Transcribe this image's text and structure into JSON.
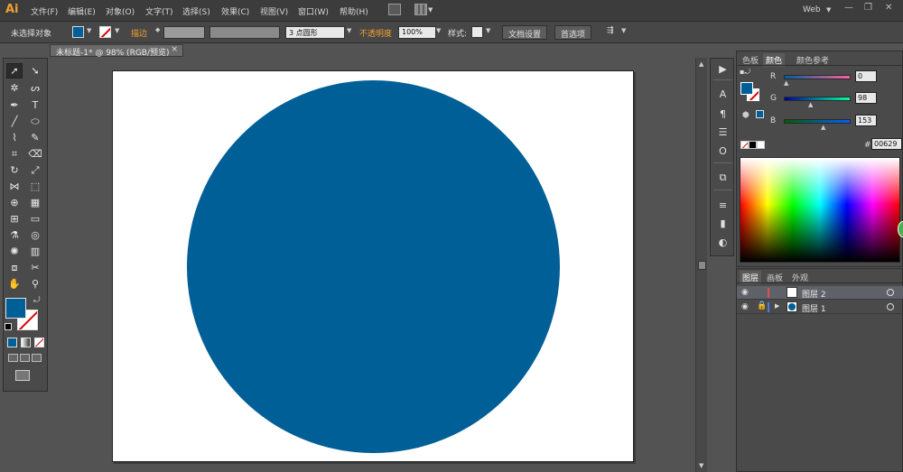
{
  "app": {
    "logo": "Ai"
  },
  "menubar": {
    "items": [
      "文件(F)",
      "编辑(E)",
      "对象(O)",
      "文字(T)",
      "选择(S)",
      "效果(C)",
      "视图(V)",
      "窗口(W)",
      "帮助(H)"
    ],
    "workspace": "Web",
    "window_controls": [
      "—",
      "❐",
      "✕"
    ]
  },
  "controlbar": {
    "selection_status": "未选择对象",
    "stroke_label": "描边",
    "brush_value": "3 点圆形",
    "opacity_label": "不透明度",
    "opacity_value": "100%",
    "style_label": "样式:",
    "doc_setup_button": "文档设置",
    "preferences_button": "首选项"
  },
  "document": {
    "tab_title": "未标题-1* @ 98% (RGB/预览)",
    "close": "×"
  },
  "artwork": {
    "circle_color": "#005f96",
    "artboard_color": "#ffffff"
  },
  "color_panel": {
    "tabs": [
      "色板",
      "颜色",
      "颜色参考"
    ],
    "active_tab": "颜色",
    "channels": [
      {
        "label": "R",
        "value": "0"
      },
      {
        "label": "G",
        "value": "98"
      },
      {
        "label": "B",
        "value": "153"
      }
    ],
    "hex_label": "#",
    "hex_value": "00629"
  },
  "layers_panel": {
    "tabs": [
      "图层",
      "画板",
      "外观"
    ],
    "active_tab": "图层",
    "layers": [
      {
        "name": "图层 2",
        "color": "#e05050",
        "selected": true
      },
      {
        "name": "图层 1",
        "color": "#4a7be0",
        "selected": false
      }
    ]
  },
  "colors": {
    "fill": "#005f96",
    "stroke": "none",
    "accent_orange": "#f0a030"
  }
}
